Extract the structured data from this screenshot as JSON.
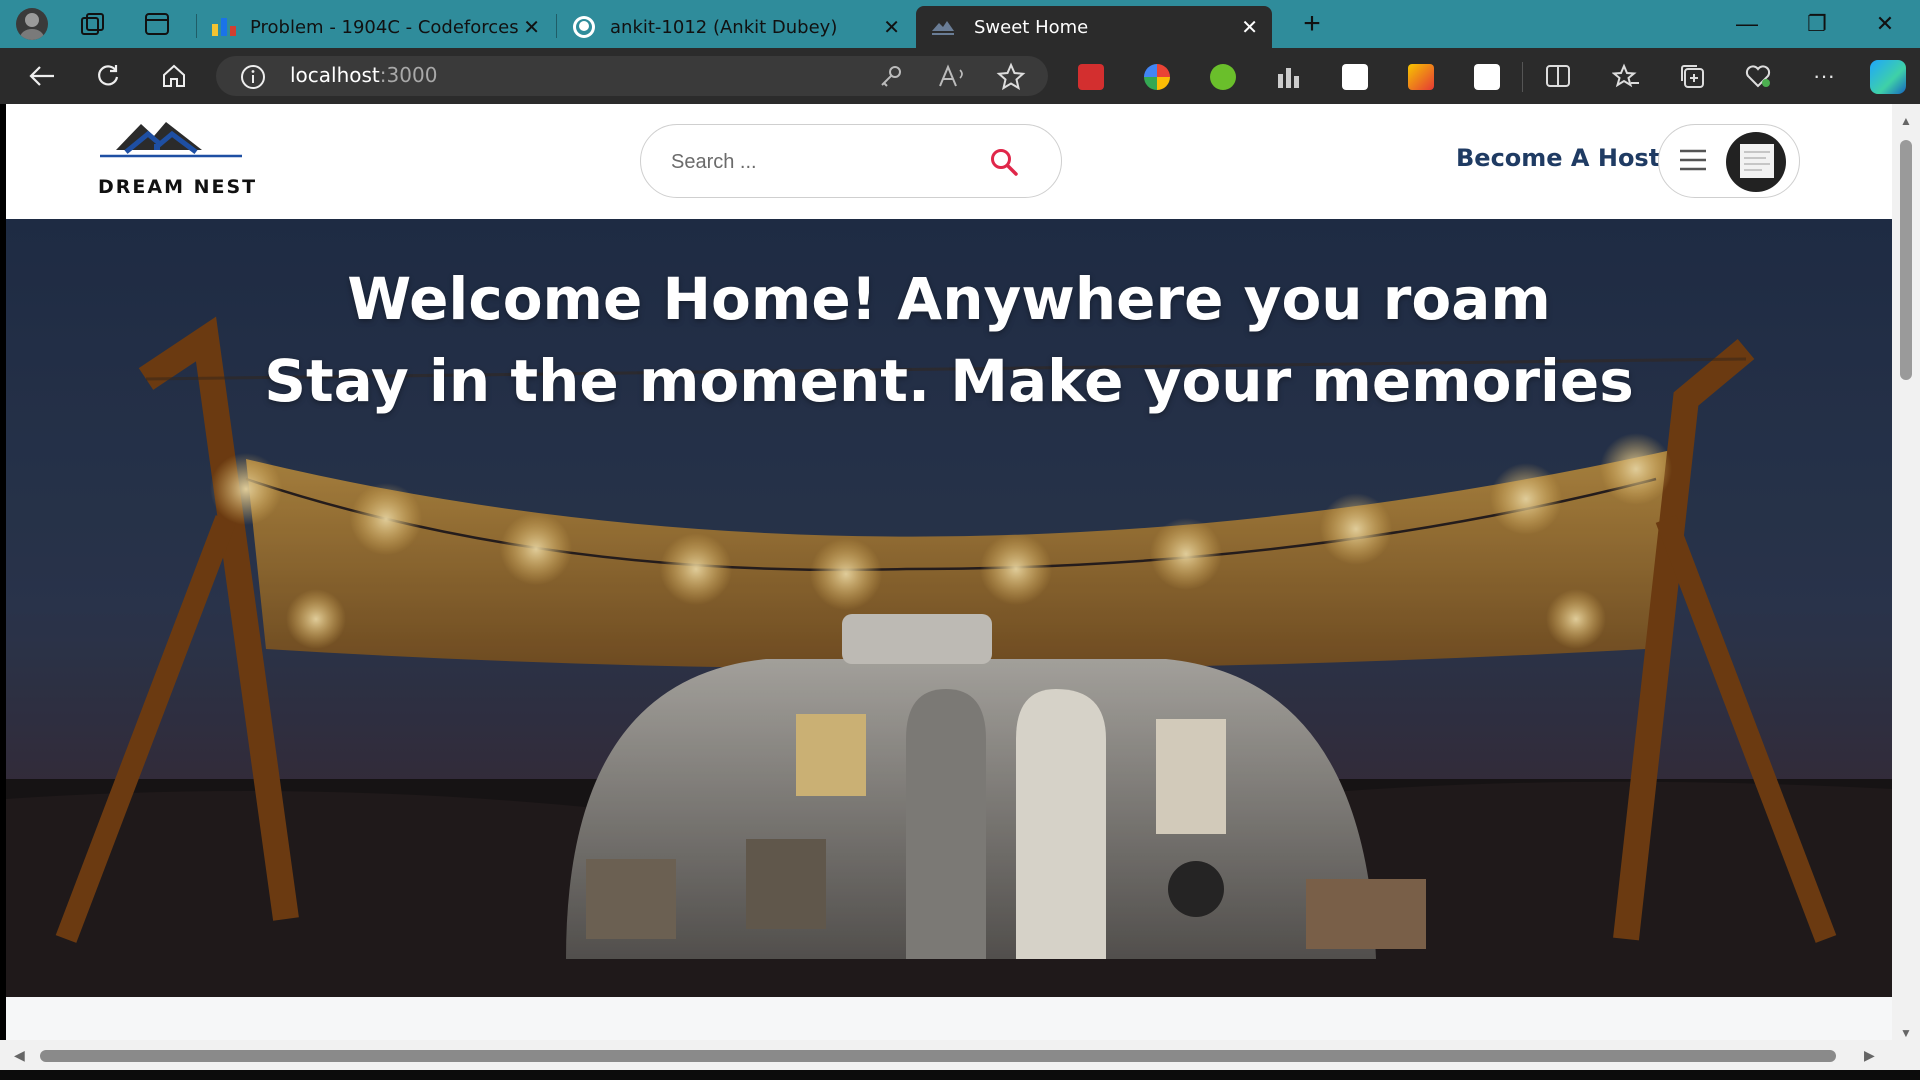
{
  "browser": {
    "tabs": [
      {
        "title": "Problem - 1904C - Codeforces"
      },
      {
        "title": "ankit-1012 (Ankit Dubey)"
      },
      {
        "title": "Sweet Home"
      }
    ],
    "new_tab_label": "+",
    "address": {
      "host": "localhost",
      "port": ":3000"
    },
    "window_controls": {
      "minimize": "—",
      "restore": "❐",
      "close": "✕"
    },
    "menu_label": "···"
  },
  "site": {
    "logo_text": "DREAM NEST",
    "search_placeholder": "Search ...",
    "become_host": "Become A Host"
  },
  "hero": {
    "line1": "Welcome Home! Anywhere you roam",
    "line2": "Stay in the moment. Make your memories"
  },
  "colors": {
    "tabbar": "#2f8c9b",
    "toolbar": "#2b2b2b",
    "brand_navy": "#1f3b63",
    "search_icon": "#e0274a"
  }
}
